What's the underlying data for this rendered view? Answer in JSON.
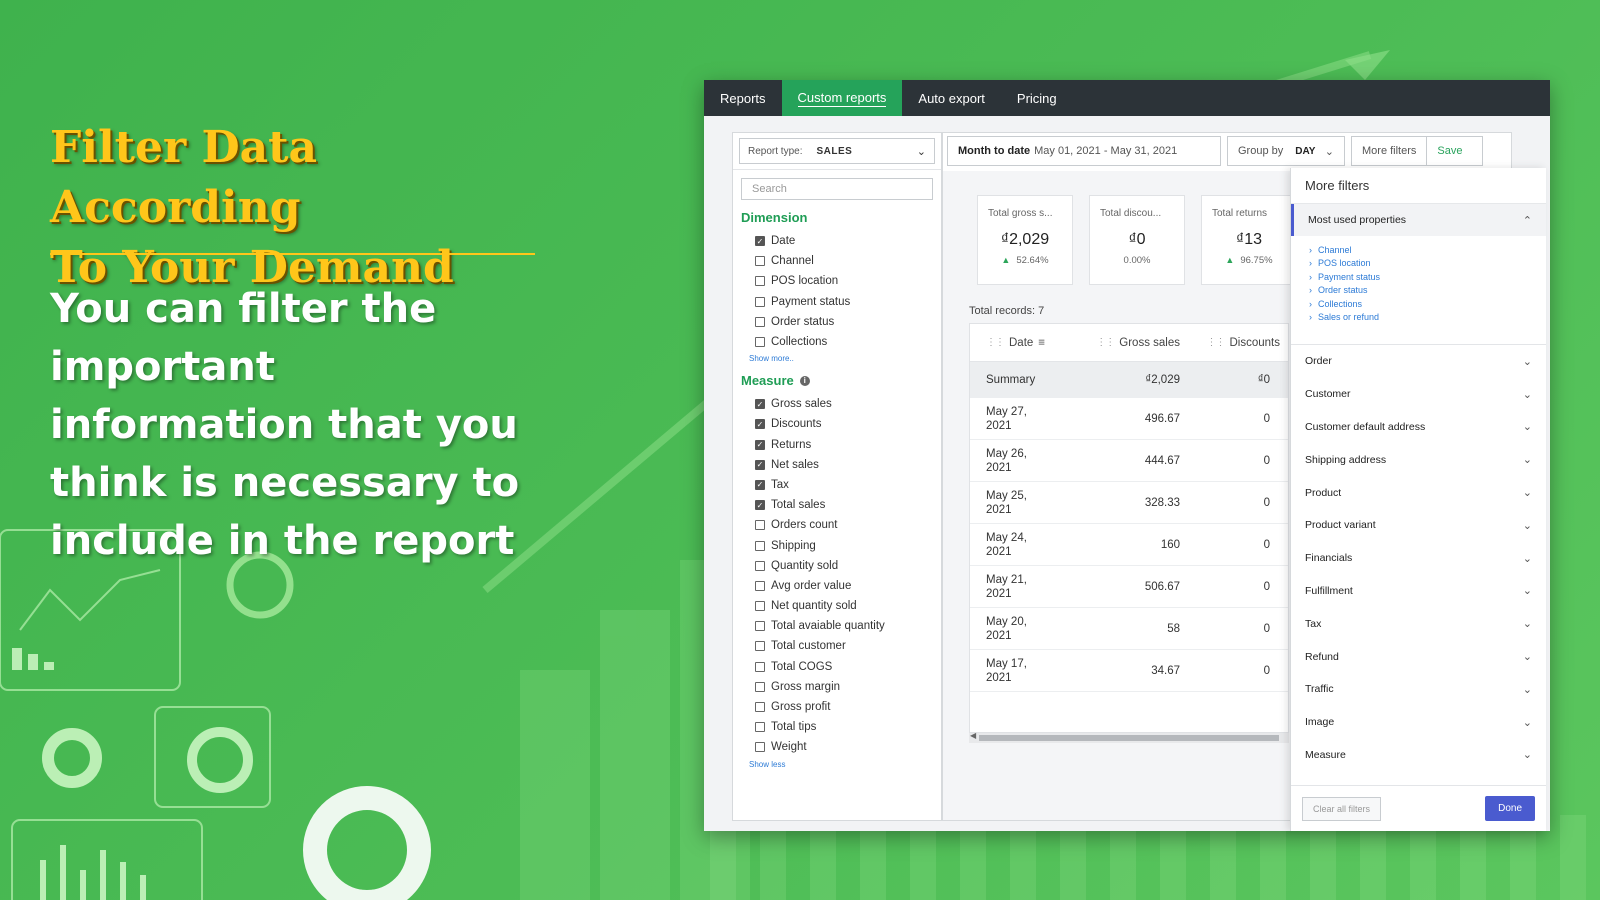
{
  "hero": {
    "title": "Filter Data According\nTo Your Demand",
    "body": "You can filter the important information that you think is necessary to include in the report"
  },
  "colors": {
    "accent": "#25a35a",
    "nav_bg": "#2c3338",
    "primary": "#4a5bcf",
    "hero_title": "#ffc61a"
  },
  "nav": {
    "tabs": [
      "Reports",
      "Custom reports",
      "Auto export",
      "Pricing"
    ],
    "active": "Custom reports"
  },
  "left": {
    "report_type_label": "Report type:",
    "report_type_value": "SALES",
    "search_placeholder": "Search",
    "dimension_title": "Dimension",
    "dimensions": [
      {
        "label": "Date",
        "checked": true
      },
      {
        "label": "Channel",
        "checked": false
      },
      {
        "label": "POS location",
        "checked": false
      },
      {
        "label": "Payment status",
        "checked": false
      },
      {
        "label": "Order status",
        "checked": false
      },
      {
        "label": "Collections",
        "checked": false
      }
    ],
    "show_more": "Show more..",
    "measure_title": "Measure",
    "measures": [
      {
        "label": "Gross sales",
        "checked": true
      },
      {
        "label": "Discounts",
        "checked": true
      },
      {
        "label": "Returns",
        "checked": true
      },
      {
        "label": "Net sales",
        "checked": true
      },
      {
        "label": "Tax",
        "checked": true
      },
      {
        "label": "Total sales",
        "checked": true
      },
      {
        "label": "Orders count",
        "checked": false
      },
      {
        "label": "Shipping",
        "checked": false
      },
      {
        "label": "Quantity sold",
        "checked": false
      },
      {
        "label": "Avg order value",
        "checked": false
      },
      {
        "label": "Net quantity sold",
        "checked": false
      },
      {
        "label": "Total avaiable quantity",
        "checked": false
      },
      {
        "label": "Total customer",
        "checked": false
      },
      {
        "label": "Total COGS",
        "checked": false
      },
      {
        "label": "Gross margin",
        "checked": false
      },
      {
        "label": "Gross profit",
        "checked": false
      },
      {
        "label": "Total tips",
        "checked": false
      },
      {
        "label": "Weight",
        "checked": false
      }
    ],
    "show_less": "Show less"
  },
  "filters": {
    "range_label": "Month to date",
    "range_value": "May 01, 2021 - May 31, 2021",
    "group_by_label": "Group by",
    "group_by_value": "DAY",
    "more_filters": "More filters",
    "save": "Save"
  },
  "kpis": [
    {
      "title": "Total gross s...",
      "value": "₫2,029",
      "pct": "52.64%",
      "up": true
    },
    {
      "title": "Total discou...",
      "value": "₫0",
      "pct": "0.00%",
      "up": false
    },
    {
      "title": "Total returns",
      "value": "₫13",
      "pct": "96.75%",
      "up": true
    }
  ],
  "table": {
    "total_records": "Total records: 7",
    "headers": [
      "Date",
      "Gross sales",
      "Discounts"
    ],
    "summary": {
      "label": "Summary",
      "gross": "₫2,029",
      "disc": "₫0"
    },
    "rows": [
      {
        "d1": "May 27,",
        "d2": "2021",
        "gross": "496.67",
        "disc": "0"
      },
      {
        "d1": "May 26,",
        "d2": "2021",
        "gross": "444.67",
        "disc": "0"
      },
      {
        "d1": "May 25,",
        "d2": "2021",
        "gross": "328.33",
        "disc": "0"
      },
      {
        "d1": "May 24,",
        "d2": "2021",
        "gross": "160",
        "disc": "0"
      },
      {
        "d1": "May 21,",
        "d2": "2021",
        "gross": "506.67",
        "disc": "0"
      },
      {
        "d1": "May 20,",
        "d2": "2021",
        "gross": "58",
        "disc": "0"
      },
      {
        "d1": "May 17,",
        "d2": "2021",
        "gross": "34.67",
        "disc": "0"
      }
    ]
  },
  "drawer": {
    "title": "More filters",
    "most_used": "Most used properties",
    "most_used_items": [
      "Channel",
      "POS location",
      "Payment status",
      "Order status",
      "Collections",
      "Sales or refund"
    ],
    "sections": [
      "Order",
      "Customer",
      "Customer default address",
      "Shipping address",
      "Product",
      "Product variant",
      "Financials",
      "Fulfillment",
      "Tax",
      "Refund",
      "Traffic",
      "Image",
      "Measure"
    ],
    "clear": "Clear all filters",
    "done": "Done"
  }
}
